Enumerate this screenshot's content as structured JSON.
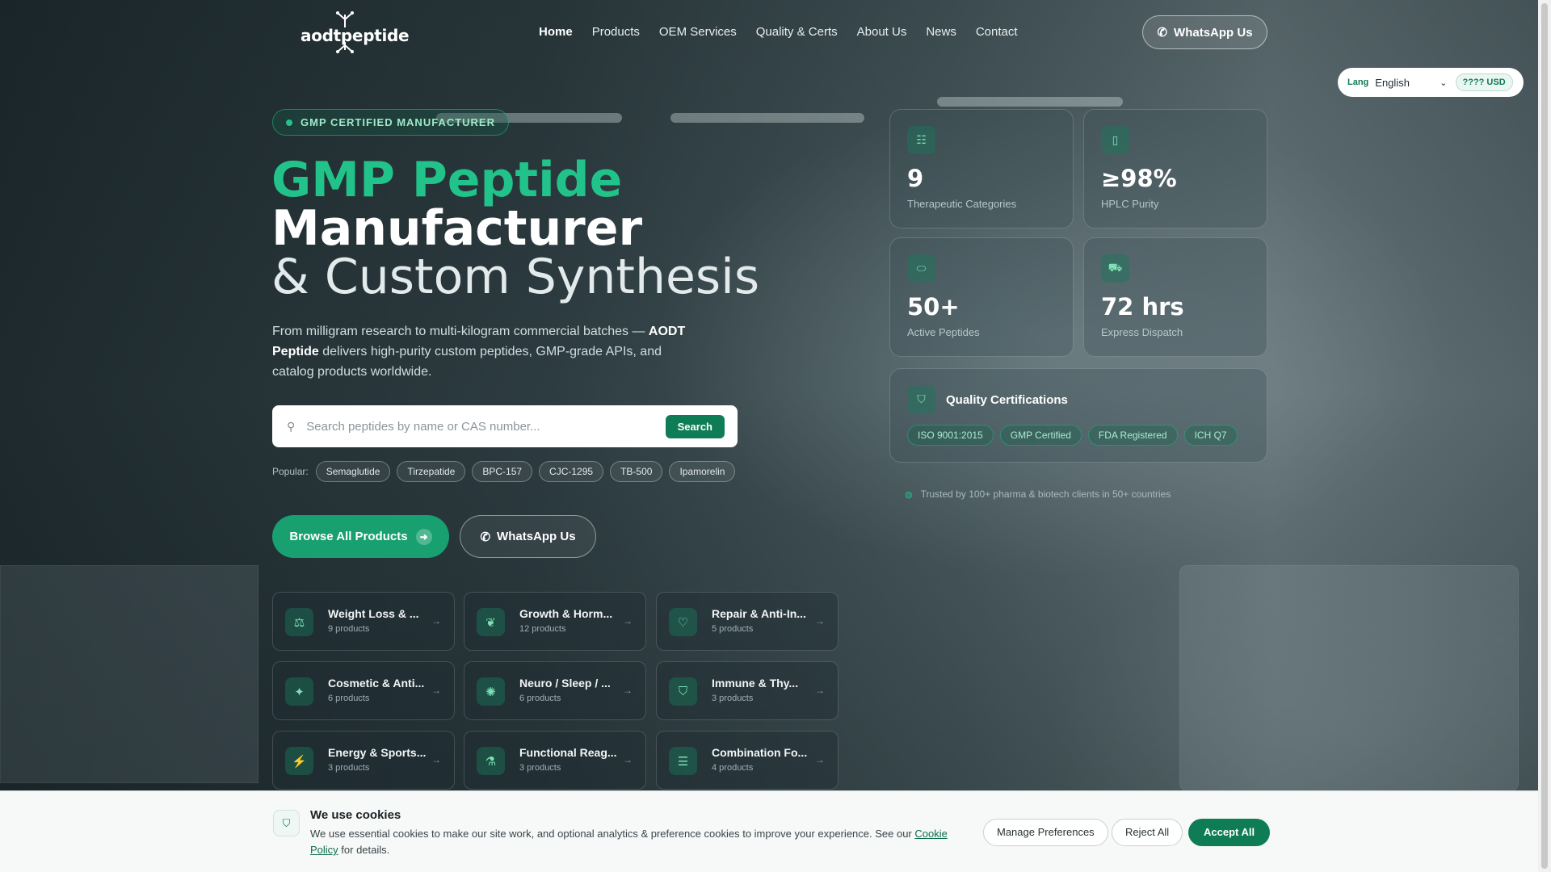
{
  "brand": {
    "name": "aodtpeptide"
  },
  "nav": {
    "items": [
      "Home",
      "Products",
      "OEM Services",
      "Quality & Certs",
      "About Us",
      "News",
      "Contact"
    ],
    "whatsapp_label": "WhatsApp Us"
  },
  "lang_switch": {
    "label": "Lang",
    "selected": "English",
    "currency": "???? USD"
  },
  "hero": {
    "badge": "GMP CERTIFIED MANUFACTURER",
    "title_line1": "GMP Peptide",
    "title_line2": "Manufacturer",
    "title_line3": "& Custom Synthesis",
    "lede_before": "From milligram research to multi-kilogram commercial batches — ",
    "lede_brand": "AODT Peptide",
    "lede_after": " delivers high-purity custom peptides, GMP-grade APIs, and catalog products worldwide.",
    "search_placeholder": "Search peptides by name or CAS number...",
    "search_button": "Search",
    "popular_label": "Popular:",
    "popular_chips": [
      "Semaglutide",
      "Tirzepatide",
      "BPC-157",
      "CJC-1295",
      "TB-500",
      "Ipamorelin"
    ],
    "cta_primary": "Browse All Products",
    "cta_secondary": "WhatsApp Us"
  },
  "categories": [
    {
      "name": "Weight Loss & ...",
      "count": "9 products",
      "icon": "scale-icon"
    },
    {
      "name": "Growth & Horm...",
      "count": "12 products",
      "icon": "sprout-icon"
    },
    {
      "name": "Repair & Anti-In...",
      "count": "5 products",
      "icon": "heart-pulse-icon"
    },
    {
      "name": "Cosmetic & Anti...",
      "count": "6 products",
      "icon": "sparkles-icon"
    },
    {
      "name": "Neuro / Sleep / ...",
      "count": "6 products",
      "icon": "brain-icon"
    },
    {
      "name": "Immune & Thy...",
      "count": "3 products",
      "icon": "shield-icon"
    },
    {
      "name": "Energy & Sports...",
      "count": "3 products",
      "icon": "runner-icon"
    },
    {
      "name": "Functional Reag...",
      "count": "3 products",
      "icon": "flask-icon"
    },
    {
      "name": "Combination Fo...",
      "count": "4 products",
      "icon": "layers-icon"
    }
  ],
  "stats": [
    {
      "value": "9",
      "label": "Therapeutic Categories",
      "icon": "list-icon"
    },
    {
      "value": "≥98%",
      "label": "HPLC Purity",
      "icon": "test-tube-icon"
    },
    {
      "value": "50+",
      "label": "Active Peptides",
      "icon": "pill-icon"
    },
    {
      "value": "72 hrs",
      "label": "Express Dispatch",
      "icon": "truck-icon"
    }
  ],
  "quality": {
    "title": "Quality Certifications",
    "tags": [
      "ISO 9001:2015",
      "GMP Certified",
      "FDA Registered",
      "ICH Q7"
    ]
  },
  "trusted": "Trusted by 100+ pharma & biotech clients in 50+ countries",
  "cookie": {
    "title": "We use cookies",
    "text_before": "We use essential cookies to make our site work, and optional analytics & preference cookies to improve your experience. See our ",
    "link": "Cookie Policy",
    "text_after": " for details.",
    "manage": "Manage Preferences",
    "reject": "Reject All",
    "accept": "Accept All"
  },
  "colors": {
    "accent": "#22c38a",
    "button": "#0e7d56",
    "cta": "#18a070"
  }
}
